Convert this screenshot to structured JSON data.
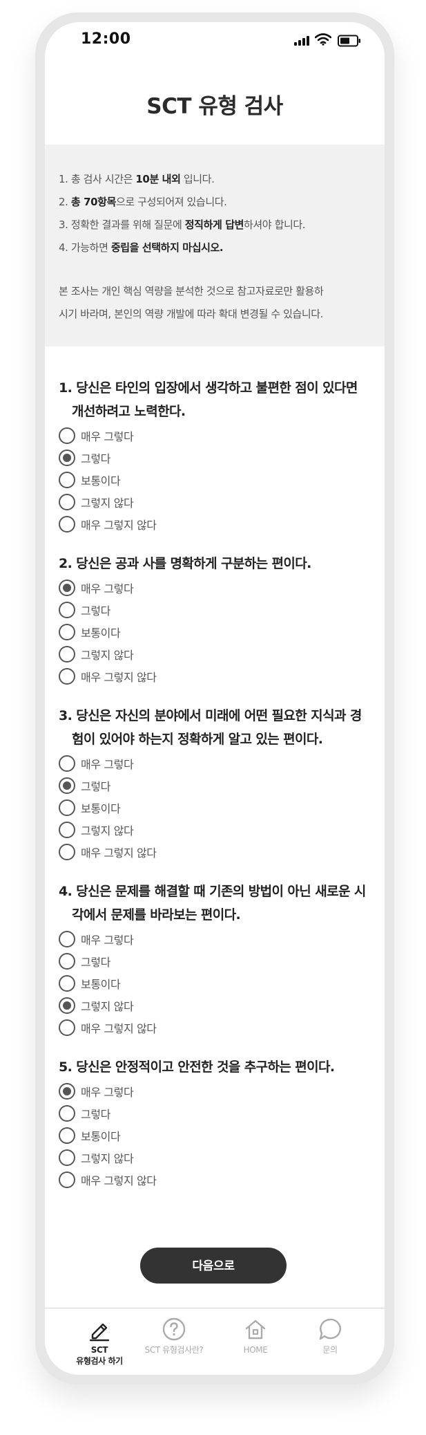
{
  "status_bar": {
    "time": "12:00"
  },
  "page_title": "SCT 유형 검사",
  "info": {
    "lines": [
      {
        "pre": "1. 총 검사 시간은 ",
        "bold": "10분 내외",
        "post": " 입니다."
      },
      {
        "pre": "2. ",
        "bold": "총 70항목",
        "post": "으로 구성되어져 있습니다."
      },
      {
        "pre": "3. 정확한 결과를 위해 질문에 ",
        "bold": "정직하게 답변",
        "post": "하셔야 합니다."
      },
      {
        "pre": "4. 가능하면 ",
        "bold": "중립을 선택하지 마십시오.",
        "post": ""
      }
    ],
    "note_line1": "본 조사는 개인 핵심 역량을 분석한 것으로 참고자료로만 활용하",
    "note_line2": "시기 바라며, 본인의 역량 개발에 따라 확대 변경될 수 있습니다."
  },
  "options": [
    "매우 그렇다",
    "그렇다",
    "보통이다",
    "그렇지 않다",
    "매우 그렇지 않다"
  ],
  "questions": [
    {
      "title": "1. 당신은 타인의 입장에서 생각하고 불편한 점이 있다면 개선하려고 노력한다.",
      "selected": 1
    },
    {
      "title": "2. 당신은 공과 사를 명확하게 구분하는 편이다.",
      "selected": 0
    },
    {
      "title": "3. 당신은 자신의 분야에서 미래에 어떤 필요한 지식과 경험이 있어야 하는지 정확하게 알고 있는 편이다.",
      "selected": 1
    },
    {
      "title": "4. 당신은 문제를 해결할 때 기존의 방법이 아닌 새로운 시각에서 문제를 바라보는 편이다.",
      "selected": 3
    },
    {
      "title": "5. 당신은 안정적이고 안전한 것을 추구하는 편이다.",
      "selected": 0
    }
  ],
  "next_button": "다음으로",
  "nav": {
    "items": [
      {
        "label_line1": "SCT",
        "label_line2": "유형검사 하기",
        "icon": "pencil-icon",
        "active": true
      },
      {
        "label_line1": "SCT 유형검사란?",
        "label_line2": "",
        "icon": "question-circle-icon",
        "active": false
      },
      {
        "label_line1": "HOME",
        "label_line2": "",
        "icon": "home-icon",
        "active": false
      },
      {
        "label_line1": "문의",
        "label_line2": "",
        "icon": "chat-bubble-icon",
        "active": false
      }
    ]
  },
  "colors": {
    "button": "#333333",
    "info_bg": "#f1f1f1",
    "frame": "#e6e6e6",
    "nav_inactive": "#aaaaaa"
  }
}
